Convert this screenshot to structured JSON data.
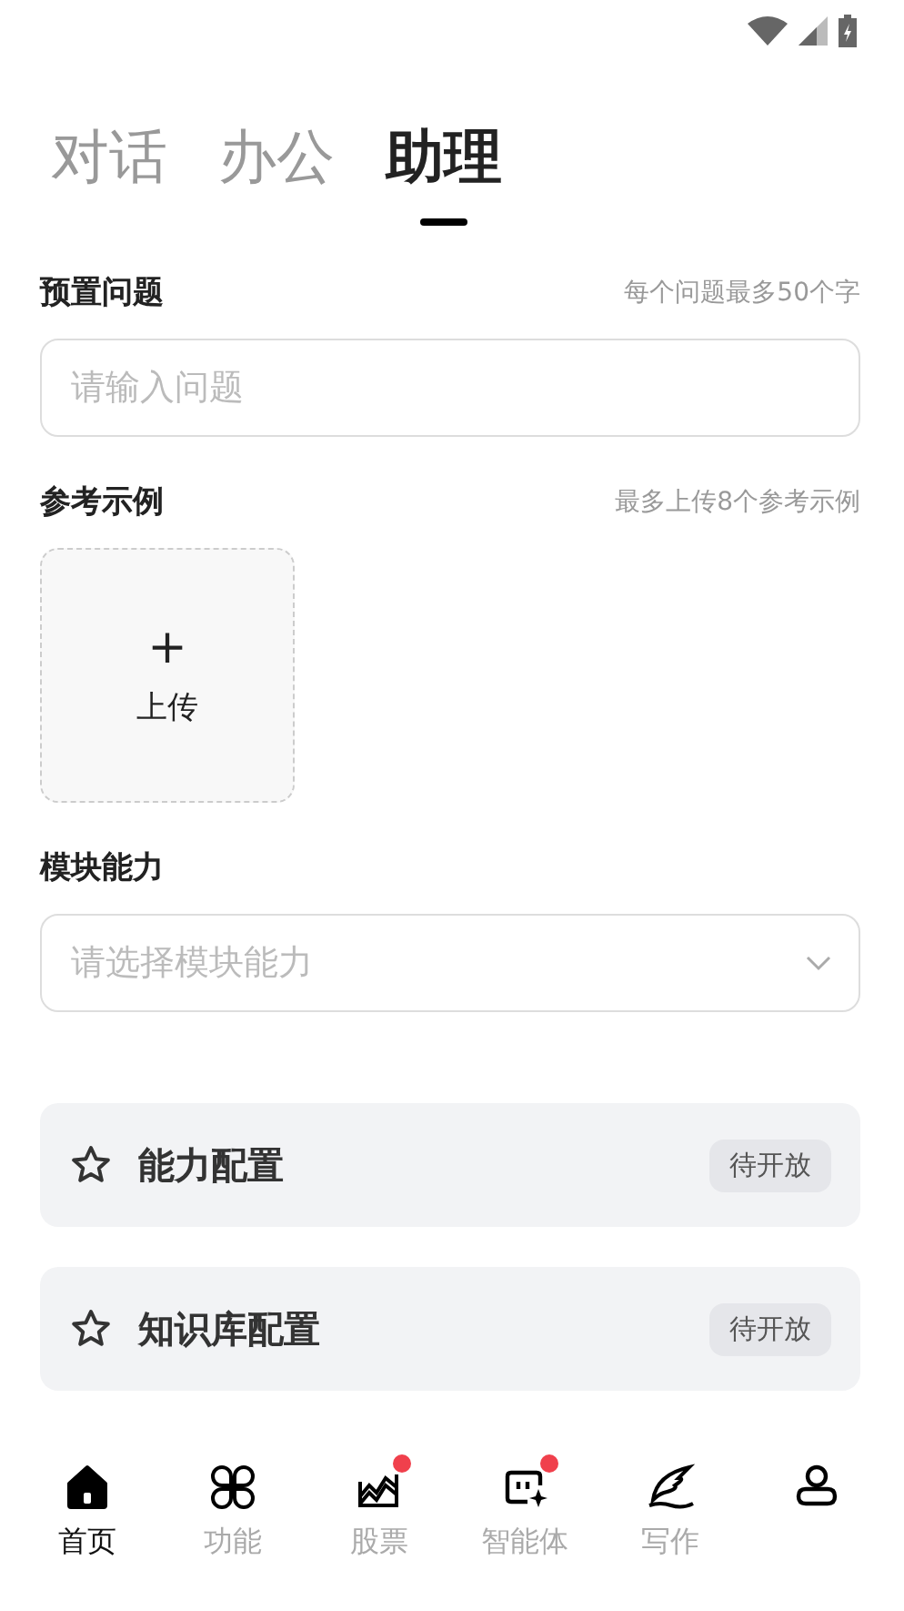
{
  "tabs": [
    {
      "label": "对话",
      "selected": false
    },
    {
      "label": "办公",
      "selected": false
    },
    {
      "label": "助理",
      "selected": true
    }
  ],
  "question": {
    "label": "预置问题",
    "hint": "每个问题最多50个字",
    "placeholder": "请输入问题"
  },
  "examples": {
    "label": "参考示例",
    "hint": "最多上传8个参考示例",
    "upload_icon": "+",
    "upload_label": "上传"
  },
  "module": {
    "label": "模块能力",
    "placeholder": "请选择模块能力"
  },
  "configs": [
    {
      "title": "能力配置",
      "badge": "待开放"
    },
    {
      "title": "知识库配置",
      "badge": "待开放"
    }
  ],
  "bottom_nav": [
    {
      "label": "首页",
      "selected": true,
      "dot": false
    },
    {
      "label": "功能",
      "selected": false,
      "dot": false
    },
    {
      "label": "股票",
      "selected": false,
      "dot": true
    },
    {
      "label": "智能体",
      "selected": false,
      "dot": true
    },
    {
      "label": "写作",
      "selected": false,
      "dot": false
    },
    {
      "selected": false,
      "dot": false
    }
  ]
}
